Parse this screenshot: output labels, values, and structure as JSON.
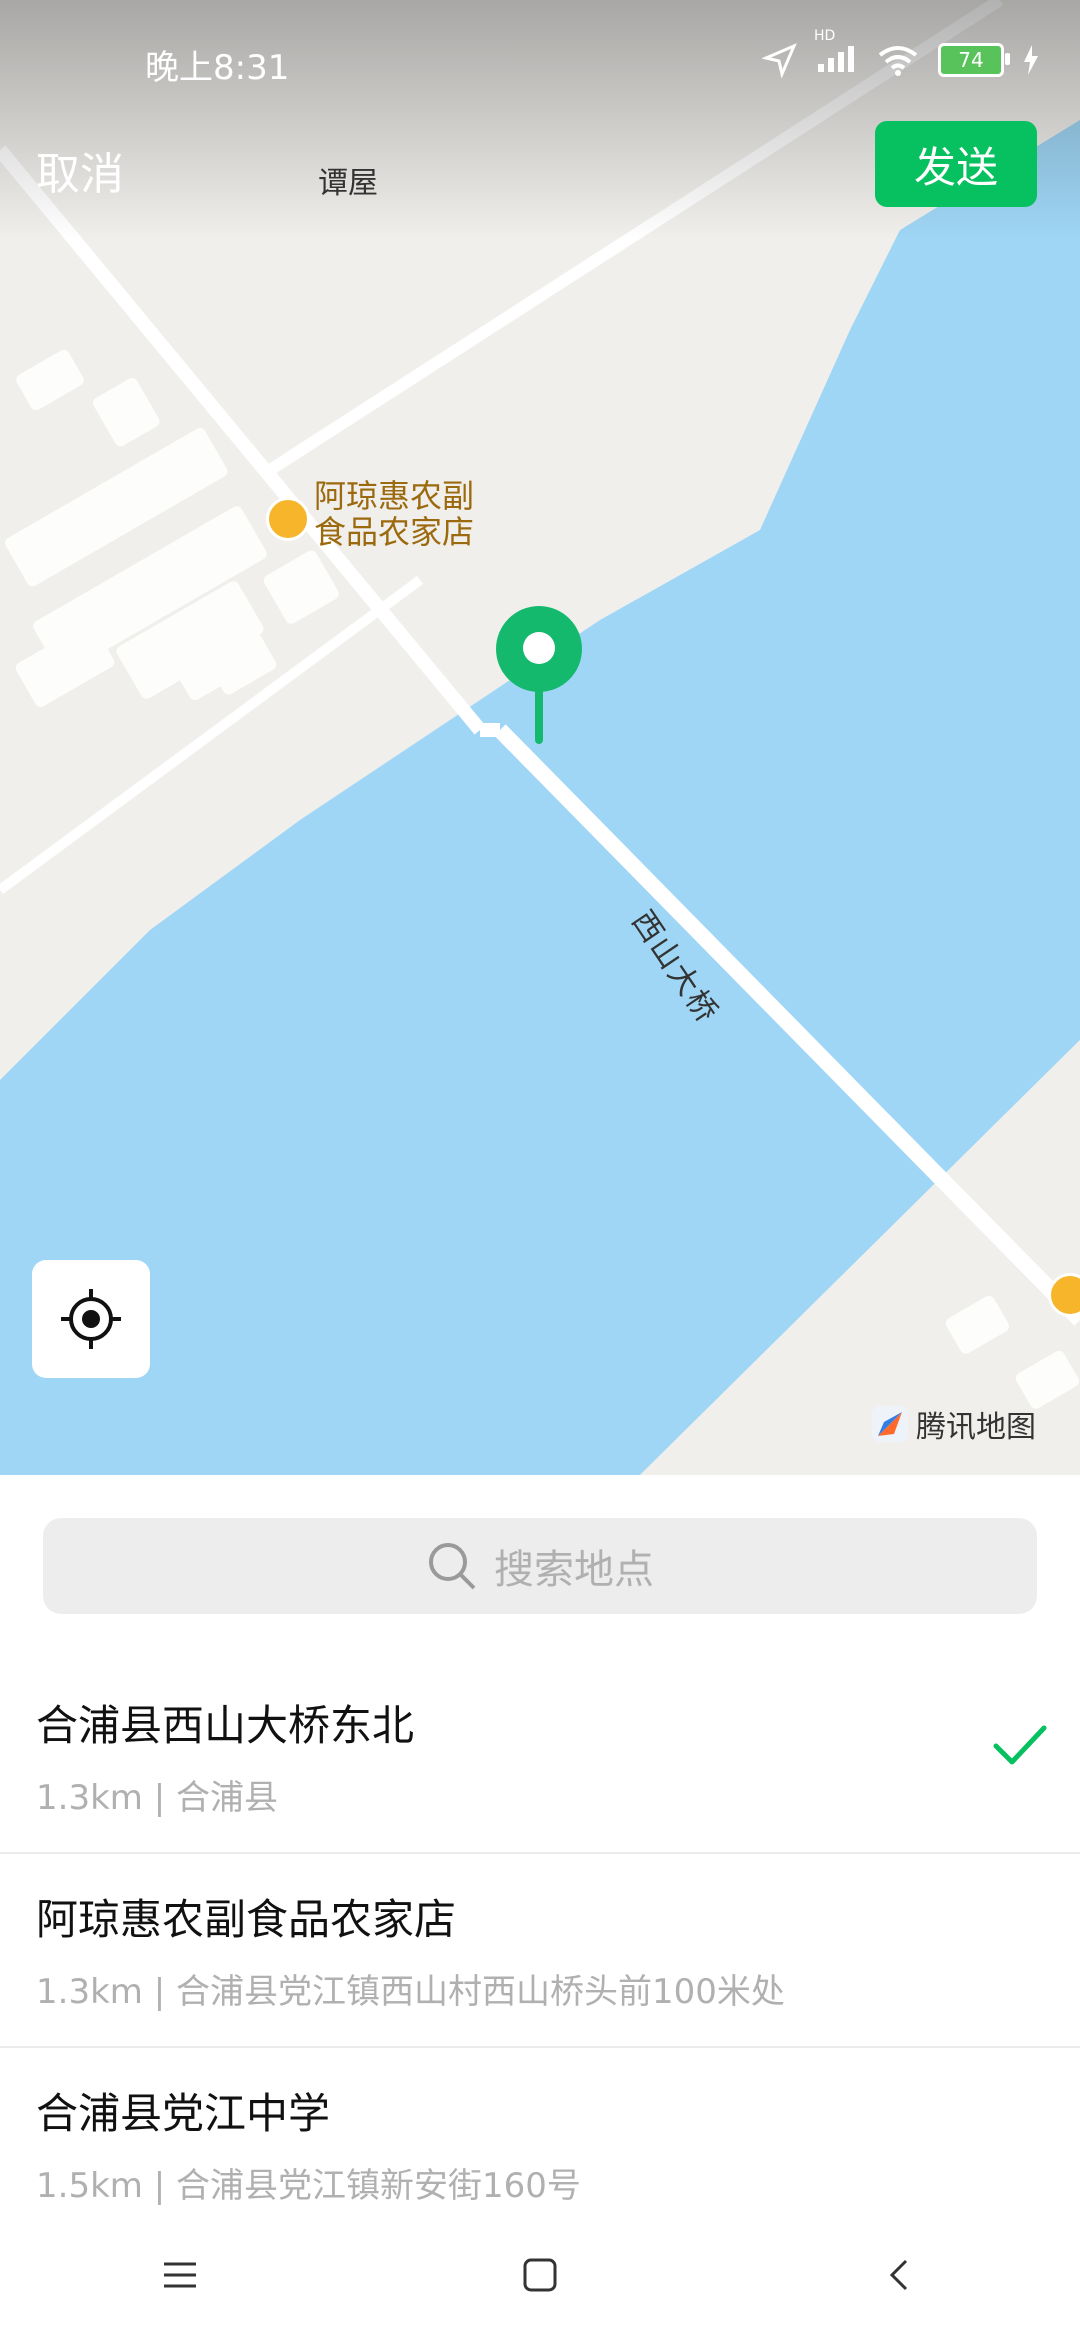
{
  "status": {
    "time": "晚上8:31",
    "battery": "74",
    "network_tag": "HD"
  },
  "header": {
    "cancel": "取消",
    "send": "发送"
  },
  "map": {
    "place_label_top": "谭屋",
    "poi_name_line1": "阿琼惠农副",
    "poi_name_line2": "食品农家店",
    "road_label": "西山大桥",
    "brand": "腾讯地图"
  },
  "search": {
    "placeholder": "搜索地点"
  },
  "results": [
    {
      "title": "合浦县西山大桥东北",
      "subtitle": "1.3km | 合浦县",
      "selected": true
    },
    {
      "title": "阿琼惠农副食品农家店",
      "subtitle": "1.3km | 合浦县党江镇西山村西山桥头前100米处",
      "selected": false
    },
    {
      "title": "合浦县党江中学",
      "subtitle": "1.5km | 合浦县党江镇新安街160号",
      "selected": false
    }
  ],
  "colors": {
    "accent": "#07c160",
    "water": "#9fd6f5",
    "pin": "#15b96e"
  },
  "icons": {
    "locate": "locate-target-icon",
    "search": "search-icon",
    "check": "checkmark-icon"
  }
}
